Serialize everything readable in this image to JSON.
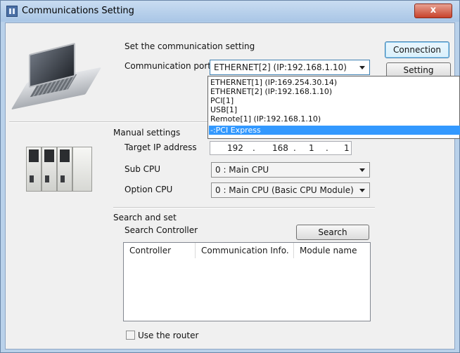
{
  "window": {
    "title": "Communications Setting",
    "close_label": "x"
  },
  "header": {
    "section_label": "Set the communication setting"
  },
  "comm_port": {
    "label": "Communication port",
    "value": "ETHERNET[2]  (IP:192.168.1.10)",
    "options": [
      "ETHERNET[1]  (IP:169.254.30.14)",
      "ETHERNET[2]  (IP:192.168.1.10)",
      "PCI[1]",
      "USB[1]",
      "Remote[1]  (IP:192.168.1.10)",
      "-:PCI Express"
    ],
    "highlighted_index": 5
  },
  "buttons": {
    "connection": "Connection",
    "setting": "Setting",
    "search": "Search"
  },
  "manual": {
    "section_label": "Manual settings",
    "target_ip_label": "Target IP address",
    "ip": [
      "192",
      "168",
      "1",
      "1"
    ],
    "ip_dot": ".",
    "sub_cpu_label": "Sub CPU",
    "sub_cpu_value": "0 : Main CPU",
    "option_cpu_label": "Option CPU",
    "option_cpu_value": "0 : Main CPU (Basic CPU Module)"
  },
  "search": {
    "section_label": "Search and set",
    "controller_label": "Search Controller",
    "columns": [
      "Controller",
      "Communication Info.",
      "Module name"
    ],
    "rows": []
  },
  "router": {
    "label": "Use the router",
    "checked": false
  },
  "icons": {
    "app": "app-icon",
    "laptop": "laptop-icon",
    "plc": "plc-icon",
    "dropdown": "chevron-down-icon"
  },
  "colors": {
    "selection": "#3399ff",
    "title_bar": "#b9d1ea",
    "close_button": "#c7432c"
  }
}
